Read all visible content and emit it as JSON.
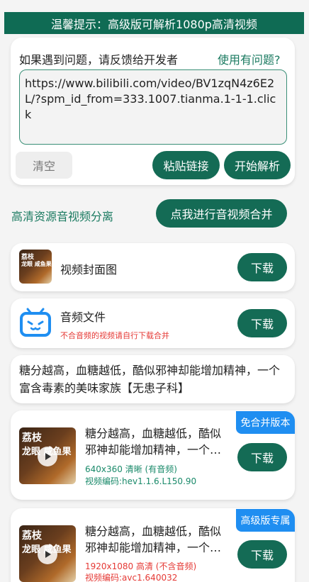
{
  "banner": {
    "text": "温馨提示：高级版可解析1080p高清视频"
  },
  "feedback": {
    "text": "如果遇到问题，请反馈给开发者",
    "link": "使用有问题?"
  },
  "url_input": {
    "value": "https://www.bilibili.com/video/BV1zqN4z6E2L/?spm_id_from=333.1007.tianma.1-1-1.click"
  },
  "buttons": {
    "clear": "清空",
    "paste": "粘贴链接",
    "parse": "开始解析",
    "merge": "点我进行音视频合并"
  },
  "section": {
    "label": "高清资源音视频分离"
  },
  "cover_item": {
    "title": "视频封面图",
    "download": "下载",
    "thumb_line1": "荔枝",
    "thumb_line2": "龙眼  咸鱼果"
  },
  "audio_item": {
    "title": "音频文件",
    "note": "不合音频的视频请自行下载合并",
    "download": "下载"
  },
  "video_title": "糖分越高，血糖越低，酷似邪神却能增加精神，一个富含毒素的美味家族【无患子科】",
  "videos": [
    {
      "badge": "免合并版本",
      "title": "糖分越高，血糖越低，酷似邪神却能增加精神，一个…",
      "quality": "640x360 清晰 (有音频)",
      "codec": "视频编码:hev1.1.6.L150.90",
      "download": "下载",
      "thumb_line1": "荔枝",
      "thumb_line2": "龙眼  咸鱼果"
    },
    {
      "badge": "高级版专属",
      "title": "糖分越高，血糖越低，酷似邪神却能增加精神，一个…",
      "quality": "1920x1080 高清 (不含音频)",
      "codec": "视频编码:avc1.640032",
      "download": "下载",
      "thumb_line1": "荔枝",
      "thumb_line2": "龙眼  咸鱼果"
    }
  ],
  "colors": {
    "primary": "#146b55",
    "accent_blue": "#1f8ef1",
    "warn_red": "#e53935",
    "info_green": "#1a8a6a"
  }
}
